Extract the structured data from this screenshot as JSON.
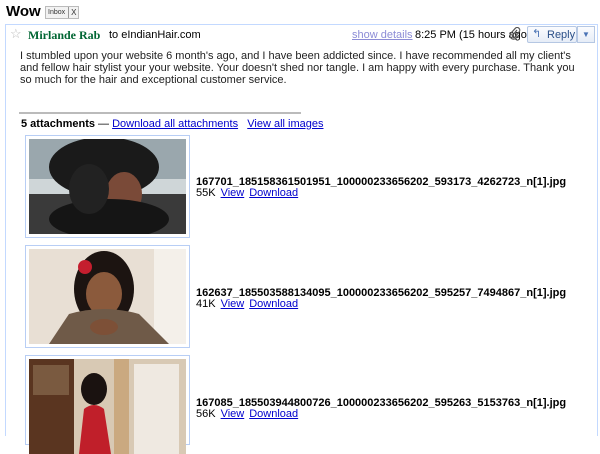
{
  "subject": "Wow",
  "label_chip": {
    "text": "Inbox",
    "close": "X"
  },
  "sender": {
    "name": "Mirlande Rab",
    "to_text": "to eIndianHair.com"
  },
  "header": {
    "show_details": "show details",
    "date": "8:25 PM (15 hours ago)",
    "reply_label": "Reply"
  },
  "body": "I stumbled upon your website 6 month's ago, and I have been addicted  since. I have recommended all my client's and fellow hair stylist your your website. Your doesn't shed nor tangle. I am happy with every purchase. Thank you so much for the hair and exceptional customer service.",
  "attachments_header": {
    "count_text": "5 attachments",
    "dash": " — ",
    "download_all": "Download all attachments",
    "view_all": "View all images"
  },
  "attachments": [
    {
      "filename": "167701_185158361501951_100000233656202_593173_4262723_n[1].jpg",
      "size": "55K",
      "view": "View",
      "download": "Download"
    },
    {
      "filename": "162637_185503588134095_100000233656202_595257_7494867_n[1].jpg",
      "size": "41K",
      "view": "View",
      "download": "Download"
    },
    {
      "filename": "167085_185503944800726_100000233656202_595263_5153763_n[1].jpg",
      "size": "56K",
      "view": "View",
      "download": "Download"
    }
  ],
  "icons": {
    "star": "star-icon",
    "paperclip": "paperclip-icon",
    "reply": "reply-arrow-icon",
    "more": "dropdown-arrow-icon"
  },
  "colors": {
    "sender": "#006633",
    "link": "#0000cc",
    "border": "#c3d9ff"
  }
}
